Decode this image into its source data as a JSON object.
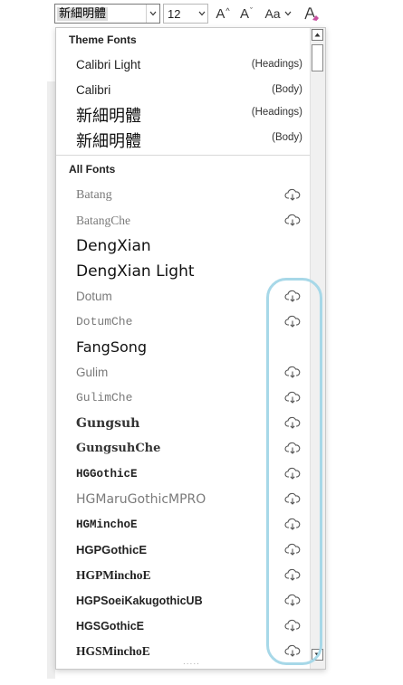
{
  "toolbar": {
    "font_name": "新細明體",
    "font_size": "12",
    "grow_label": "A",
    "shrink_label": "A",
    "case_label": "Aa",
    "colors": {
      "border": "#7a7a7a",
      "selection": "#dcdcdc"
    }
  },
  "panel": {
    "theme_header": "Theme Fonts",
    "all_header": "All Fonts",
    "theme_fonts": [
      {
        "name": "Calibri Light",
        "tag": "(Headings)"
      },
      {
        "name": "Calibri",
        "tag": "(Body)"
      },
      {
        "name": "新細明體",
        "tag": "(Headings)"
      },
      {
        "name": "新細明體",
        "tag": "(Body)"
      }
    ],
    "all_fonts": [
      {
        "name": "Batang",
        "cloud": true
      },
      {
        "name": "BatangChe",
        "cloud": true
      },
      {
        "name": "DengXian",
        "cloud": false
      },
      {
        "name": "DengXian Light",
        "cloud": false
      },
      {
        "name": "Dotum",
        "cloud": true
      },
      {
        "name": "DotumChe",
        "cloud": true
      },
      {
        "name": "FangSong",
        "cloud": false
      },
      {
        "name": "Gulim",
        "cloud": true
      },
      {
        "name": "GulimChe",
        "cloud": true
      },
      {
        "name": "Gungsuh",
        "cloud": true
      },
      {
        "name": "GungsuhChe",
        "cloud": true
      },
      {
        "name": "HGGothicE",
        "cloud": true
      },
      {
        "name": "HGMaruGothicMPRO",
        "cloud": true
      },
      {
        "name": "HGMinchoE",
        "cloud": true
      },
      {
        "name": "HGPGothicE",
        "cloud": true
      },
      {
        "name": "HGPMinchoE",
        "cloud": true
      },
      {
        "name": "HGPSoeiKakugothicUB",
        "cloud": true
      },
      {
        "name": "HGSGothicE",
        "cloud": true
      },
      {
        "name": "HGSMinchoE",
        "cloud": true
      }
    ],
    "highlight_color": "#a7d8e8"
  }
}
